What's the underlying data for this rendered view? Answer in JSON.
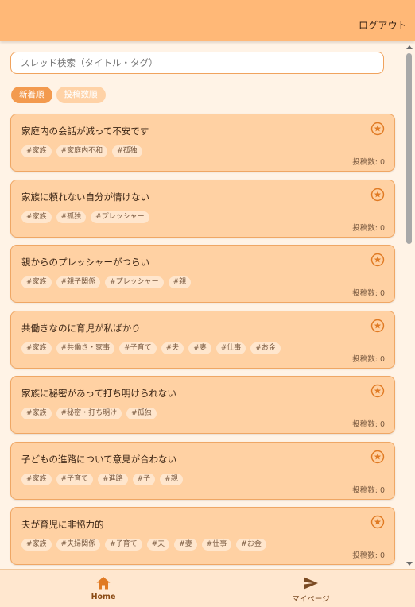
{
  "header": {
    "logout_label": "ログアウト"
  },
  "search": {
    "placeholder": "スレッド検索（タイトル・タグ）",
    "value": ""
  },
  "sort": {
    "options": [
      {
        "label": "新着順",
        "active": true
      },
      {
        "label": "投稿数順",
        "active": false
      }
    ]
  },
  "threads": [
    {
      "title": "家庭内の会話が減って不安です",
      "tags": [
        "#家族",
        "#家庭内不和",
        "#孤独"
      ],
      "post_count": "投稿数: 0"
    },
    {
      "title": "家族に頼れない自分が情けない",
      "tags": [
        "#家族",
        "#孤独",
        "#プレッシャー"
      ],
      "post_count": "投稿数: 0"
    },
    {
      "title": "親からのプレッシャーがつらい",
      "tags": [
        "#家族",
        "#親子関係",
        "#プレッシャー",
        "#親"
      ],
      "post_count": "投稿数: 0"
    },
    {
      "title": "共働きなのに育児が私ばかり",
      "tags": [
        "#家族",
        "#共働き・家事",
        "#子育て",
        "#夫",
        "#妻",
        "#仕事",
        "#お金"
      ],
      "post_count": "投稿数: 0"
    },
    {
      "title": "家族に秘密があって打ち明けられない",
      "tags": [
        "#家族",
        "#秘密・打ち明け",
        "#孤独"
      ],
      "post_count": "投稿数: 0"
    },
    {
      "title": "子どもの進路について意見が合わない",
      "tags": [
        "#家族",
        "#子育て",
        "#進路",
        "#子",
        "#親"
      ],
      "post_count": "投稿数: 0"
    },
    {
      "title": "夫が育児に非協力的",
      "tags": [
        "#家族",
        "#夫婦関係",
        "#子育て",
        "#夫",
        "#妻",
        "#仕事",
        "#お金"
      ],
      "post_count": "投稿数: 0"
    }
  ],
  "bottom_nav": {
    "home_label": "Home",
    "mypage_label": "マイページ"
  },
  "icons": {
    "favorite": "star-circle-icon",
    "home": "home-icon",
    "mypage": "send-icon"
  },
  "colors": {
    "header": "#ffb877",
    "accent": "#f39a4e",
    "card": "#ffd1a3",
    "icon": "#e07a23"
  }
}
